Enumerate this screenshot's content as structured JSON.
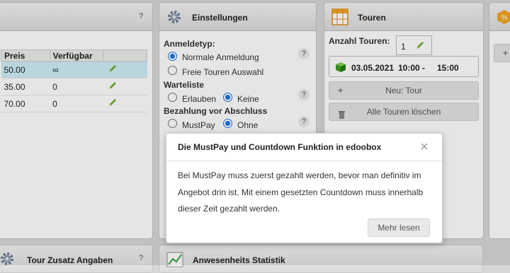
{
  "left_panel": {
    "help": "?",
    "columns": [
      "Preis",
      "Verfügbar"
    ],
    "rows": [
      {
        "preis": "50.00",
        "verfuegbar": "∞",
        "selected": true
      },
      {
        "preis": "35.00",
        "verfuegbar": "0",
        "selected": false
      },
      {
        "preis": "70.00",
        "verfuegbar": "0",
        "selected": false
      }
    ]
  },
  "settings": {
    "title": "Einstellungen",
    "anmeldetyp_label": "Anmeldetyp:",
    "anmeldetyp_options": [
      "Normale Anmeldung",
      "Freie Touren Auswahl"
    ],
    "anmeldetyp_selected": 0,
    "warteliste_label": "Warteliste",
    "warteliste_options": [
      "Erlauben",
      "Keine"
    ],
    "warteliste_selected": 1,
    "bezahlung_label": "Bezahlung vor Abschluss",
    "bezahlung_options": [
      "MustPay",
      "Ohne"
    ],
    "bezahlung_selected": 1,
    "help": "?"
  },
  "touren": {
    "title": "Touren",
    "anzahl_label": "Anzahl Touren:",
    "anzahl_value": "1",
    "tour_date": "03.05.2021",
    "tour_time": "10:00 -",
    "tour_end": "15:00",
    "new_button": "Neu: Tour",
    "delete_button": "Alle Touren löschen"
  },
  "bottom": {
    "left_title": "Tour Zusatz Angaben",
    "left_help": "?",
    "center_title": "Anwesenheits Statistik"
  },
  "modal": {
    "title": "Die MustPay und Countdown Funktion in edoobox",
    "close": "×",
    "body": "Bei MustPay muss zuerst gezahlt werden, bevor man definitiv im Angebot drin ist. Mit einem gesetzten Countdown muss innerhalb dieser Zeit gezahlt werden.",
    "button": "Mehr lesen"
  },
  "colors": {
    "accent": "#1a73e8",
    "selected_row": "#cfeef8",
    "pencil": "#6cae2f",
    "orange": "#f0a623"
  }
}
